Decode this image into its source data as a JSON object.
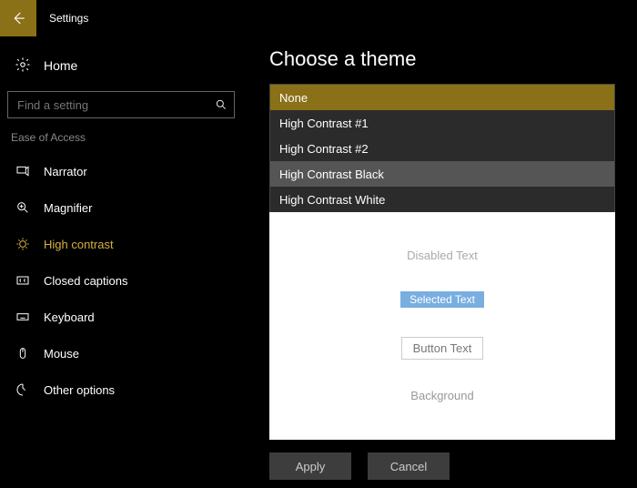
{
  "titlebar": {
    "title": "Settings"
  },
  "sidebar": {
    "home_label": "Home",
    "search_placeholder": "Find a setting",
    "section_label": "Ease of Access",
    "items": [
      {
        "label": "Narrator",
        "icon": "narrator-icon"
      },
      {
        "label": "Magnifier",
        "icon": "magnifier-icon"
      },
      {
        "label": "High contrast",
        "icon": "high-contrast-icon"
      },
      {
        "label": "Closed captions",
        "icon": "closed-captions-icon"
      },
      {
        "label": "Keyboard",
        "icon": "keyboard-icon"
      },
      {
        "label": "Mouse",
        "icon": "mouse-icon"
      },
      {
        "label": "Other options",
        "icon": "other-options-icon"
      }
    ],
    "active_index": 2
  },
  "content": {
    "heading": "Choose a theme",
    "theme_options": [
      "None",
      "High Contrast #1",
      "High Contrast #2",
      "High Contrast Black",
      "High Contrast White"
    ],
    "selected_theme_index": 0,
    "hover_theme_index": 3,
    "preview": {
      "disabled_text": "Disabled Text",
      "selected_text": "Selected Text",
      "button_text": "Button Text",
      "background_text": "Background"
    },
    "buttons": {
      "apply": "Apply",
      "cancel": "Cancel"
    }
  },
  "colors": {
    "accent": "#8a7118",
    "accent_text": "#d6b13a"
  }
}
